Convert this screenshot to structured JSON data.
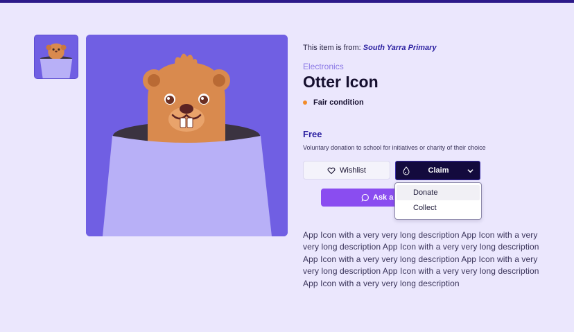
{
  "source": {
    "prefix": "This item is from:",
    "school": "South Yarra Primary"
  },
  "item": {
    "category": "Electronics",
    "title": "Otter Icon",
    "condition": "Fair condition",
    "price": "Free",
    "price_note": "Voluntary donation to school for initiatives or charity of their choice",
    "description": "App Icon with a very very long description App Icon with a very very long description App Icon with a very very long description App Icon with a very very long description App Icon with a very very long description App Icon with a very very long description App Icon with a very very long description"
  },
  "actions": {
    "wishlist_label": "Wishlist",
    "claim_label": "Claim",
    "ask_label": "Ask a question"
  },
  "claim_menu": {
    "options": [
      "Donate",
      "Collect"
    ]
  },
  "colors": {
    "page_bg": "#ebe7fd",
    "accent": "#2a1fa0",
    "image_bg": "#705fe3",
    "condition_dot": "#f28c2a",
    "ask_button": "#8a4df0",
    "claim_button": "#130a3d"
  },
  "icons": [
    "heart-icon",
    "droplet-icon",
    "chevron-down-icon",
    "chat-bubble-icon"
  ]
}
